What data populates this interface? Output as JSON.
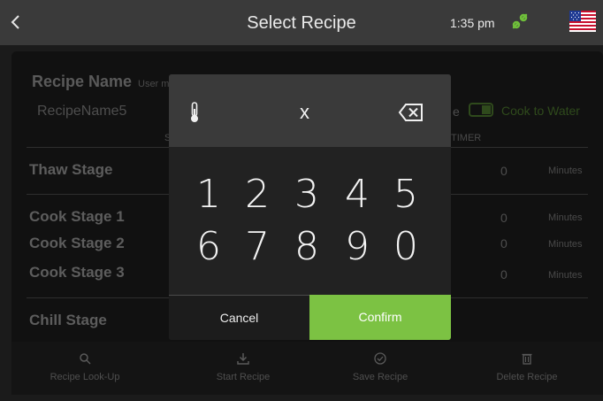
{
  "header": {
    "title": "Select Recipe",
    "time": "1:35 pm"
  },
  "background": {
    "recipe_name_label": "Recipe Name",
    "recipe_name_hint": "User m",
    "recipe_name_value": "RecipeName5",
    "cook_to_water_label": "Cook to Water",
    "cook_to_water_prefix": "e",
    "column_s": "S",
    "timer_label": "TIMER",
    "stages": [
      {
        "name": "Thaw Stage",
        "value": "0",
        "unit": "Minutes"
      },
      {
        "name": "Cook Stage 1",
        "value": "0",
        "unit": "Minutes"
      },
      {
        "name": "Cook Stage 2",
        "value": "0",
        "unit": "Minutes"
      },
      {
        "name": "Cook Stage 3",
        "value": "0",
        "unit": "Minutes"
      },
      {
        "name": "Chill Stage"
      }
    ]
  },
  "toolbar": {
    "items": [
      {
        "label": "Recipe Look-Up",
        "icon": "search-icon"
      },
      {
        "label": "Start Recipe",
        "icon": "download-icon"
      },
      {
        "label": "Save Recipe",
        "icon": "check-circle-icon"
      },
      {
        "label": "Delete Recipe",
        "icon": "trash-icon"
      }
    ]
  },
  "keypad": {
    "display": "x",
    "keys_row1": [
      "1",
      "2",
      "3",
      "4",
      "5"
    ],
    "keys_row2": [
      "6",
      "7",
      "8",
      "9",
      "0"
    ],
    "cancel_label": "Cancel",
    "confirm_label": "Confirm"
  },
  "colors": {
    "accent_green": "#7cc243",
    "topbar": "#3a3a3a",
    "background": "#1b1b1b"
  }
}
